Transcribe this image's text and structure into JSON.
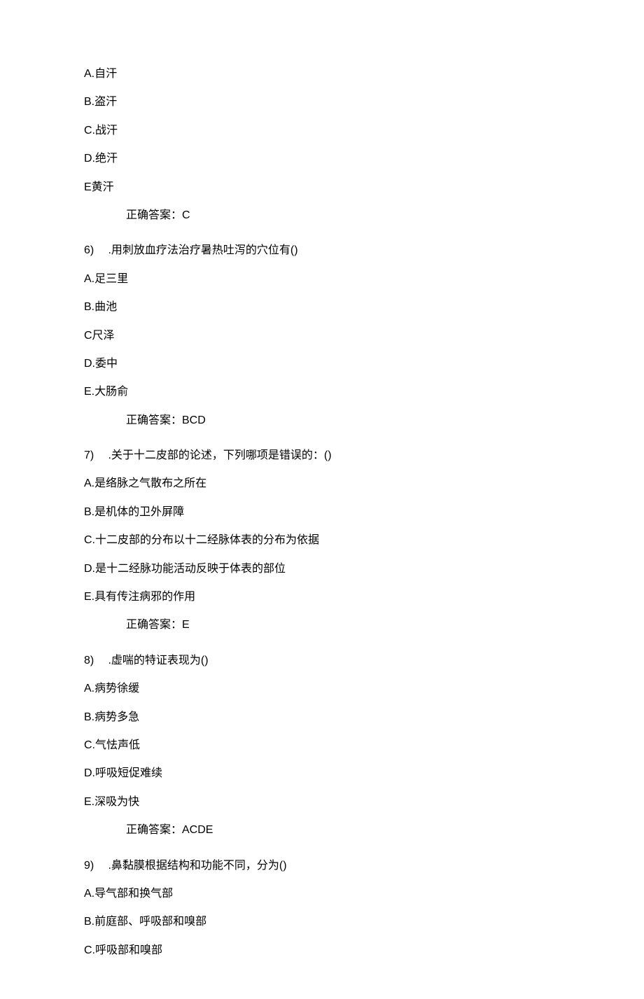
{
  "q5_partial": {
    "options": {
      "A": "A.自汗",
      "B": "B.盗汗",
      "C": "C.战汗",
      "D": "D.绝汗",
      "E": "E黄汗"
    },
    "answer": "正确答案：C"
  },
  "q6": {
    "number": "6)",
    "text": ".用刺放血疗法治疗暑热吐泻的穴位有()",
    "options": {
      "A": "A.足三里",
      "B": "B.曲池",
      "C": "C尺泽",
      "D": "D.委中",
      "E": "E.大肠俞"
    },
    "answer": "正确答案：BCD"
  },
  "q7": {
    "number": "7)",
    "text": ".关于十二皮部的论述，下列哪项是错误的：()",
    "options": {
      "A": "A.是络脉之气散布之所在",
      "B": "B.是机体的卫外屏障",
      "C": "C.十二皮部的分布以十二经脉体表的分布为依据",
      "D": "D.是十二经脉功能活动反映于体表的部位",
      "E": "E.具有传注病邪的作用"
    },
    "answer": "正确答案：E"
  },
  "q8": {
    "number": "8)",
    "text": ".虚喘的特证表现为()",
    "options": {
      "A": "A.病势徐缓",
      "B": "B.病势多急",
      "C": "C.气怯声低",
      "D": "D.呼吸短促难续",
      "E": "E.深吸为快"
    },
    "answer": "正确答案：ACDE"
  },
  "q9": {
    "number": "9)",
    "text": ".鼻黏膜根据结构和功能不同，分为()",
    "options": {
      "A": "A.导气部和换气部",
      "B": "B.前庭部、呼吸部和嗅部",
      "C": "C.呼吸部和嗅部"
    }
  }
}
